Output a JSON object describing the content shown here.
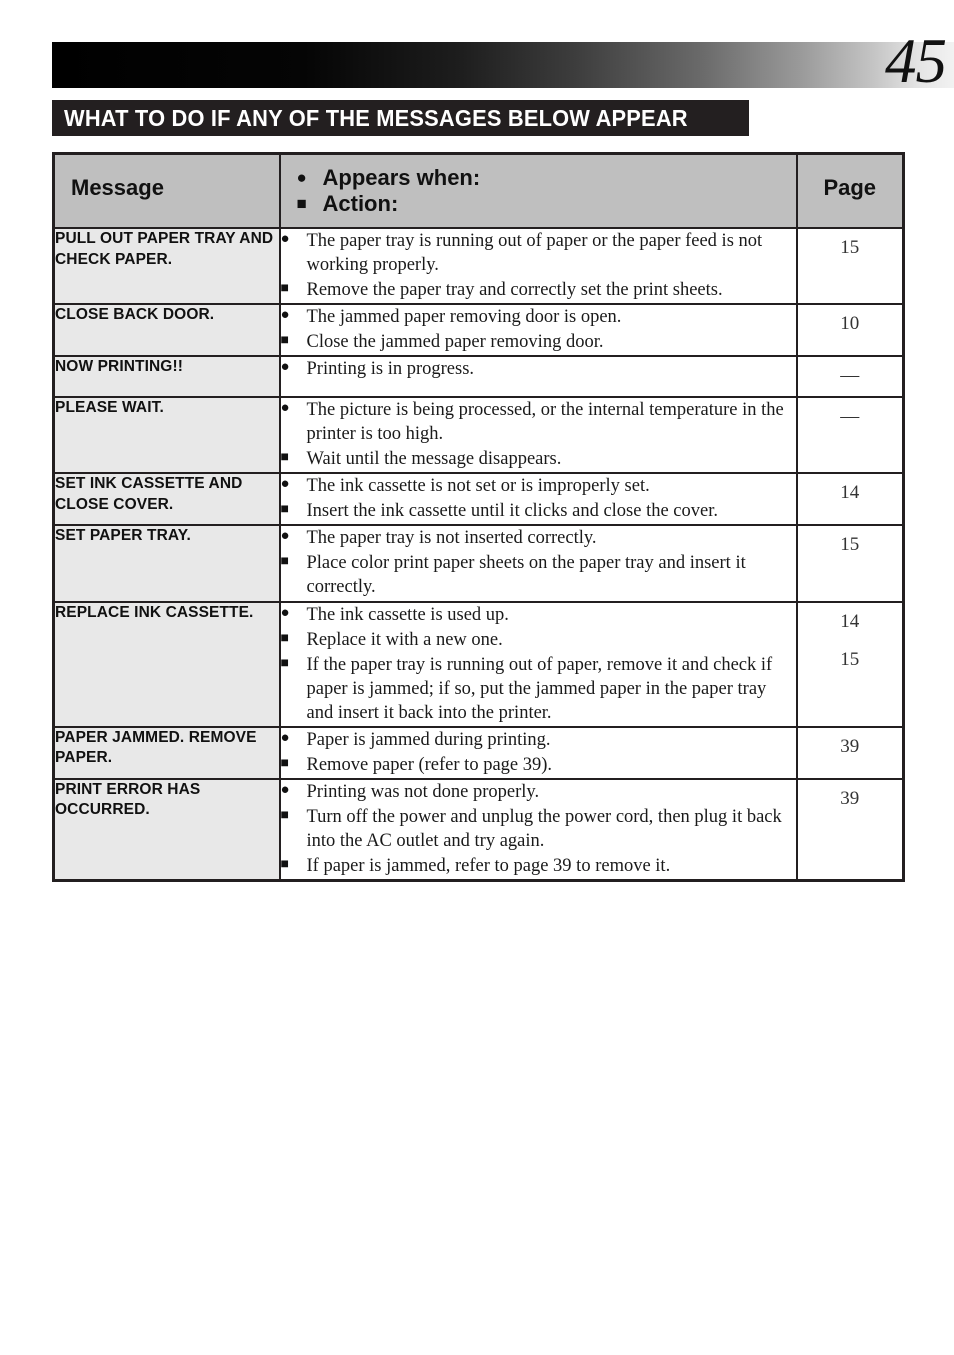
{
  "page": {
    "number": "45"
  },
  "section": {
    "title": "WHAT TO DO IF ANY OF THE MESSAGES BELOW APPEAR"
  },
  "table": {
    "headers": {
      "message": "Message",
      "appears_when": "Appears when:",
      "action": "Action:",
      "page": "Page",
      "circle_marker": "●",
      "square_marker": "■"
    },
    "rows": [
      {
        "message": "PULL OUT PAPER TRAY AND CHECK PAPER.",
        "items": [
          {
            "marker": "circle",
            "text": "The paper tray is running out of paper or the paper feed is not working properly."
          },
          {
            "marker": "square",
            "text": "Remove the paper tray and correctly set the print sheets."
          }
        ],
        "pages": [
          "15"
        ]
      },
      {
        "message": "CLOSE BACK DOOR.",
        "items": [
          {
            "marker": "circle",
            "text": "The jammed paper removing door is open."
          },
          {
            "marker": "square",
            "text": "Close the jammed paper removing door."
          }
        ],
        "pages": [
          "10"
        ]
      },
      {
        "message": "NOW PRINTING!!",
        "items": [
          {
            "marker": "circle",
            "text": "Printing is in progress."
          }
        ],
        "pages": [
          "—"
        ]
      },
      {
        "message": "PLEASE WAIT.",
        "items": [
          {
            "marker": "circle",
            "text": "The picture is being processed, or the internal temperature in the printer is too high."
          },
          {
            "marker": "square",
            "text": "Wait until the message disappears."
          }
        ],
        "pages": [
          "—"
        ]
      },
      {
        "message": "SET INK CASSETTE AND CLOSE COVER.",
        "items": [
          {
            "marker": "circle",
            "text": "The ink cassette is not set or is improperly set."
          },
          {
            "marker": "square",
            "text": "Insert the ink cassette until it clicks and close the cover."
          }
        ],
        "pages": [
          "14"
        ]
      },
      {
        "message": "SET PAPER TRAY.",
        "items": [
          {
            "marker": "circle",
            "text": "The paper tray is not inserted correctly."
          },
          {
            "marker": "square",
            "text": "Place color print paper sheets on the paper tray and insert it correctly."
          }
        ],
        "pages": [
          "15"
        ]
      },
      {
        "message": "REPLACE INK CASSETTE.",
        "items": [
          {
            "marker": "circle",
            "text": "The ink cassette is used up."
          },
          {
            "marker": "square",
            "text": "Replace it with a new one."
          },
          {
            "marker": "square",
            "text": "If the paper tray is running out of paper, remove it and check if paper is jammed; if so, put the jammed paper in the paper tray and insert it back into the printer."
          }
        ],
        "pages": [
          "14",
          "15"
        ]
      },
      {
        "message": "PAPER JAMMED. REMOVE PAPER.",
        "items": [
          {
            "marker": "circle",
            "text": "Paper is jammed during printing."
          },
          {
            "marker": "square",
            "text": "Remove paper (refer to page 39)."
          }
        ],
        "pages": [
          "39"
        ]
      },
      {
        "message": "PRINT ERROR HAS OCCURRED.",
        "items": [
          {
            "marker": "circle",
            "text": "Printing was not done properly."
          },
          {
            "marker": "square",
            "text": "Turn off the power and unplug the power cord, then plug it back into the AC outlet and try again."
          },
          {
            "marker": "square",
            "text": "If paper is jammed, refer to page 39 to remove it."
          }
        ],
        "pages": [
          "39"
        ]
      }
    ]
  },
  "colors": {
    "ink": "#231f20",
    "header_fill": "#bfbfbf",
    "message_fill": "#e8e8e8"
  }
}
